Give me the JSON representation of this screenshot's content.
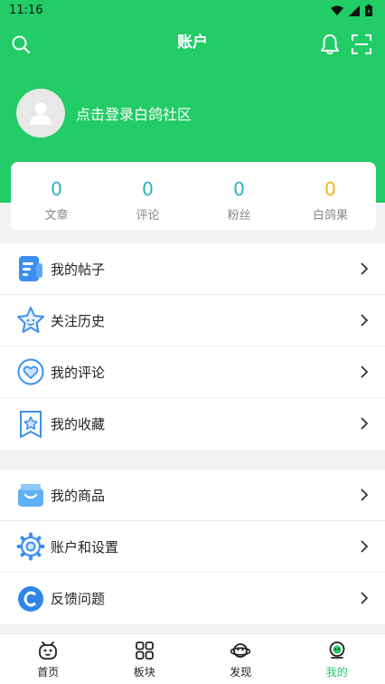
{
  "status_bar": {
    "time": "11:16"
  },
  "header": {
    "title": "账户"
  },
  "profile": {
    "login_text": "点击登录白鸽社区"
  },
  "stats": [
    {
      "value": "0",
      "label": "文章",
      "color": "#2bb0c4"
    },
    {
      "value": "0",
      "label": "评论",
      "color": "#2bb0c4"
    },
    {
      "value": "0",
      "label": "粉丝",
      "color": "#2bb0c4"
    },
    {
      "value": "0",
      "label": "白鸽果",
      "color": "#f5b70a"
    }
  ],
  "menu_group_1": [
    {
      "label": "我的帖子",
      "icon": "posts-icon"
    },
    {
      "label": "关注历史",
      "icon": "star-face-icon"
    },
    {
      "label": "我的评论",
      "icon": "heart-comment-icon"
    },
    {
      "label": "我的收藏",
      "icon": "bookmark-star-icon"
    }
  ],
  "menu_group_2": [
    {
      "label": "我的商品",
      "icon": "gift-box-icon"
    },
    {
      "label": "账户和设置",
      "icon": "gear-icon"
    },
    {
      "label": "反馈问题",
      "icon": "feedback-icon"
    }
  ],
  "tabs": [
    {
      "label": "首页",
      "icon": "home-face-icon"
    },
    {
      "label": "板块",
      "icon": "grid-icon"
    },
    {
      "label": "发现",
      "icon": "planet-icon"
    },
    {
      "label": "我的",
      "icon": "profile-robot-icon",
      "active": true
    }
  ],
  "colors": {
    "brand": "#22cc66",
    "accent_blue": "#3b8ff0",
    "stat_teal": "#2bb0c4",
    "stat_gold": "#f5b70a"
  }
}
